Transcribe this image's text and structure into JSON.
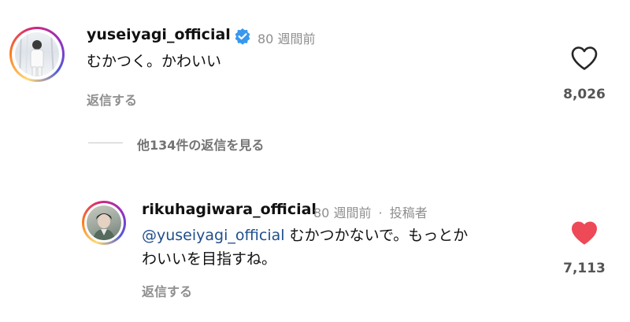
{
  "comment": {
    "username": "yuseiyagi_official",
    "time": "80 週間前",
    "text": "むかつく。かわいい",
    "reply_label": "返信する",
    "like_count": "8,026",
    "view_replies": "他134件の返信を見る"
  },
  "reply": {
    "username": "rikuhagiwara_official",
    "time": "80 週間前",
    "separator": "·",
    "author_badge": "投稿者",
    "mention": "@yuseiyagi_official",
    "text_line1": " むかつかないで。もっとか",
    "text_line2": "わいいを目指すね。",
    "reply_label": "返信する",
    "like_count": "7,113"
  },
  "colors": {
    "liked_heart": "#ed4956",
    "verified": "#3897f0",
    "mention": "#1f4e8c"
  },
  "icons": [
    "verified-icon",
    "heart-outline-icon",
    "heart-filled-icon"
  ]
}
